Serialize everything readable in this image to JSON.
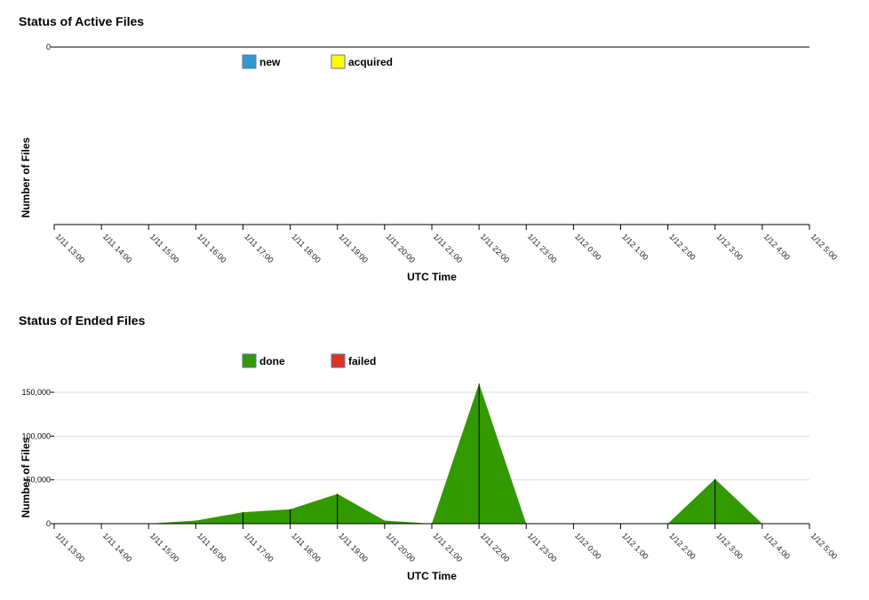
{
  "chart_data": [
    {
      "type": "area",
      "title": "Status of Active Files",
      "xlabel": "UTC Time",
      "ylabel": "Number of Files",
      "x": [
        "1/11 13:00",
        "1/11 14:00",
        "1/11 15:00",
        "1/11 16:00",
        "1/11 17:00",
        "1/11 18:00",
        "1/11 19:00",
        "1/11 20:00",
        "1/11 21:00",
        "1/11 22:00",
        "1/11 23:00",
        "1/12 0:00",
        "1/12 1:00",
        "1/12 2:00",
        "1/12 3:00",
        "1/12 4:00",
        "1/12 5:00"
      ],
      "yticks": [
        "0"
      ],
      "ylim": [
        0,
        0
      ],
      "grid": true,
      "legend_position": "top",
      "series": [
        {
          "name": "new",
          "color": "#3399cc",
          "values": [
            0,
            0,
            0,
            0,
            0,
            0,
            0,
            0,
            0,
            0,
            0,
            0,
            0,
            0,
            0,
            0,
            0
          ]
        },
        {
          "name": "acquired",
          "color": "#ffff00",
          "values": [
            0,
            0,
            0,
            0,
            0,
            0,
            0,
            0,
            0,
            0,
            0,
            0,
            0,
            0,
            0,
            0,
            0
          ]
        }
      ]
    },
    {
      "type": "area",
      "title": "Status of Ended Files",
      "xlabel": "UTC Time",
      "ylabel": "Number of Files",
      "x": [
        "1/11 13:00",
        "1/11 14:00",
        "1/11 15:00",
        "1/11 16:00",
        "1/11 17:00",
        "1/11 18:00",
        "1/11 19:00",
        "1/11 20:00",
        "1/11 21:00",
        "1/11 22:00",
        "1/11 23:00",
        "1/12 0:00",
        "1/12 1:00",
        "1/12 2:00",
        "1/12 3:00",
        "1/12 4:00",
        "1/12 5:00"
      ],
      "yticks": [
        "0",
        "50,000",
        "100,000",
        "150,000"
      ],
      "ylim": [
        0,
        150000
      ],
      "grid": true,
      "legend_position": "top",
      "series": [
        {
          "name": "done",
          "color": "#339900",
          "values": [
            0,
            0,
            0,
            3500,
            13000,
            16500,
            34000,
            3500,
            0,
            160000,
            0,
            0,
            0,
            0,
            51000,
            0,
            0
          ]
        },
        {
          "name": "failed",
          "color": "#dd3322",
          "values": [
            0,
            0,
            0,
            0,
            0,
            0,
            0,
            0,
            0,
            0,
            0,
            0,
            0,
            0,
            0,
            0,
            0
          ]
        }
      ]
    }
  ]
}
